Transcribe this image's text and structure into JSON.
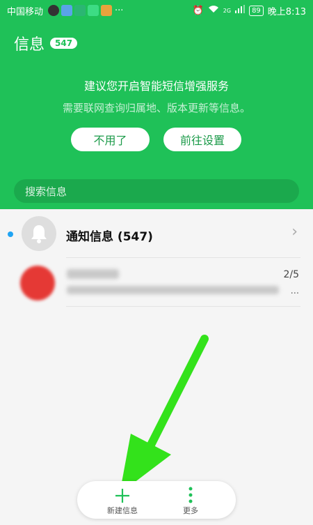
{
  "status_bar": {
    "carrier": "中国移动",
    "more": "···",
    "network": "2G",
    "battery": "89",
    "time": "晚上8:13"
  },
  "header": {
    "title": "信息",
    "badge": "547"
  },
  "promo": {
    "title": "建议您开启智能短信增强服务",
    "subtitle": "需要联网查询归属地、版本更新等信息。",
    "decline_label": "不用了",
    "settings_label": "前往设置"
  },
  "search": {
    "placeholder": "搜索信息"
  },
  "conversations": [
    {
      "title": "通知信息 (547)",
      "icon": "bell-icon",
      "unread": true
    },
    {
      "count": "2/5",
      "ellipsis": "..."
    }
  ],
  "bottom_bar": {
    "new_label": "新建信息",
    "more_label": "更多"
  },
  "colors": {
    "brand": "#1fc158",
    "unread_dot": "#20a4f3",
    "annotation_arrow": "#33e21b"
  }
}
